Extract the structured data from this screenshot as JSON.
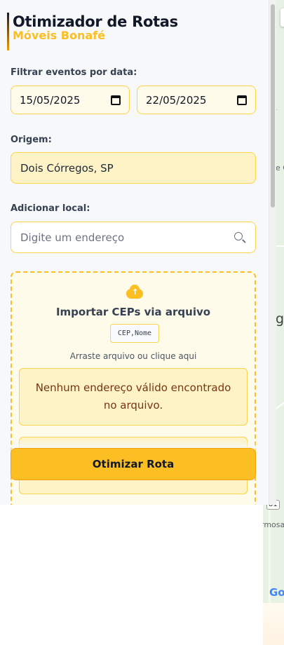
{
  "brand": {
    "title": "Otimizador de Rotas",
    "subtitle": "Móveis Bonafé"
  },
  "filters": {
    "label": "Filtrar eventos por data:",
    "start_date": "15/05/2025",
    "end_date": "22/05/2025"
  },
  "origin": {
    "label": "Origem:",
    "value": "Dois Córregos, SP"
  },
  "add_location": {
    "label": "Adicionar local:",
    "placeholder": "Digite um endereço"
  },
  "import": {
    "title": "Importar CEPs via arquivo",
    "format": "CEP,Nome",
    "hint": "Arraste arquivo ou clique aqui",
    "message": "Nenhum endereço válido encontrado no arquivo."
  },
  "actions": {
    "optimize_label": "Otimizar Rota"
  },
  "map": {
    "labels": [
      "gr",
      "e C",
      "g",
      "rmosa"
    ],
    "shield": "81",
    "logo_fragment": "Go"
  },
  "colors": {
    "accent": "#fbbf24",
    "accent_border": "#fcd34d",
    "panel_bg": "#f7f8fa"
  }
}
